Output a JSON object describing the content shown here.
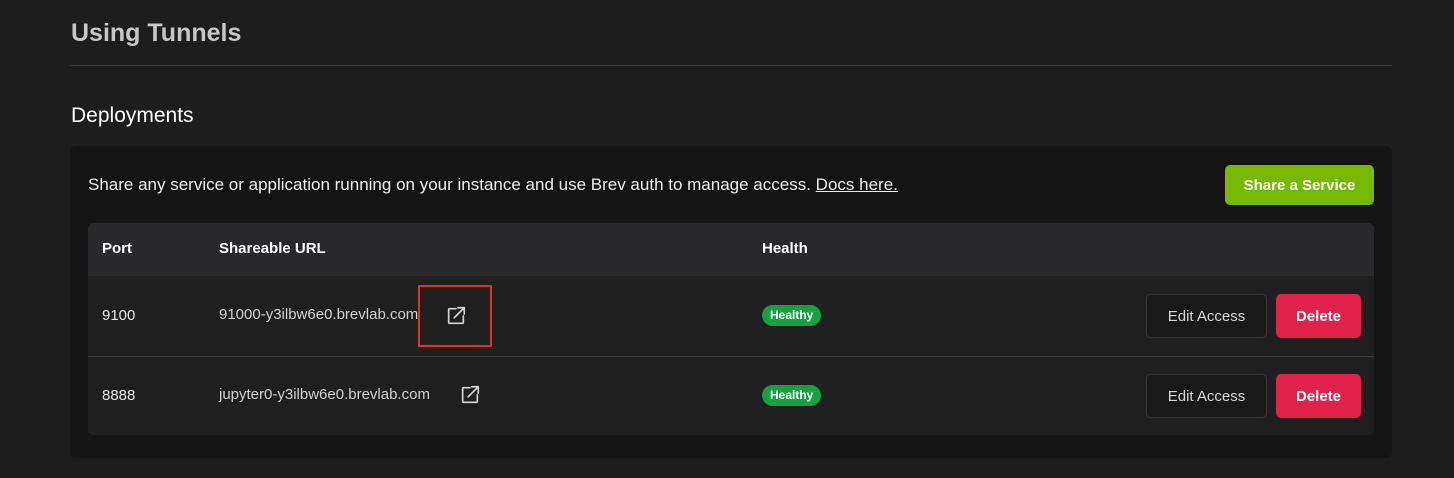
{
  "section": {
    "title": "Using Tunnels"
  },
  "deployments": {
    "title": "Deployments",
    "description": "Share any service or application running on your instance and use Brev auth to manage access.",
    "docs_link": "Docs here.",
    "share_button": "Share a Service",
    "table": {
      "headers": {
        "port": "Port",
        "url": "Shareable URL",
        "health": "Health"
      },
      "rows": [
        {
          "port": "9100",
          "url": "91000-y3ilbw6e0.brevlab.com",
          "health": "Healthy",
          "edit_label": "Edit Access",
          "delete_label": "Delete"
        },
        {
          "port": "8888",
          "url": "jupyter0-y3ilbw6e0.brevlab.com",
          "health": "Healthy",
          "edit_label": "Edit Access",
          "delete_label": "Delete"
        }
      ]
    }
  },
  "icons": {
    "external_link": "external-link-icon"
  },
  "colors": {
    "background": "#1d1d1e",
    "card": "#141414",
    "primary_green": "#76b900",
    "healthy_badge": "#18a045",
    "delete_red": "#e0224a",
    "highlight": "#e0321c"
  }
}
